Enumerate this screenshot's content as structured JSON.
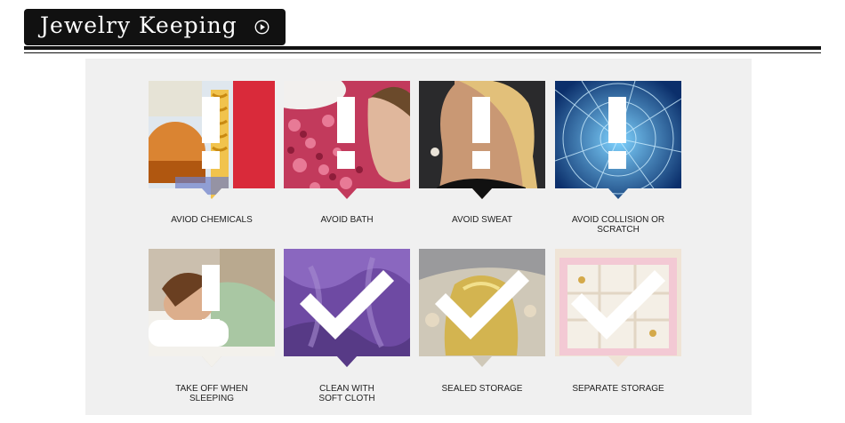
{
  "header": {
    "title": "Jewelry Keeping",
    "arrow_icon": "play-circle-icon"
  },
  "colors": {
    "header_bg": "#111111",
    "panel_bg": "#f0f0f0",
    "caption": "#222222"
  },
  "tips": [
    {
      "line1": "AVIOD CHEMICALS",
      "line2": "",
      "kind": "warning",
      "scene": "chemicals"
    },
    {
      "line1": "AVOID BATH",
      "line2": "",
      "kind": "warning",
      "scene": "bath"
    },
    {
      "line1": "AVOID SWEAT",
      "line2": "",
      "kind": "warning",
      "scene": "sweat"
    },
    {
      "line1": "AVOID COLLISION OR",
      "line2": "SCRATCH",
      "kind": "warning",
      "scene": "collision"
    },
    {
      "line1": "TAKE OFF WHEN",
      "line2": "SLEEPING",
      "kind": "warning",
      "scene": "sleeping"
    },
    {
      "line1": "CLEAN WITH",
      "line2": "SOFT CLOTH",
      "kind": "check",
      "scene": "cloth"
    },
    {
      "line1": "SEALED STORAGE",
      "line2": "",
      "kind": "check",
      "scene": "storage"
    },
    {
      "line1": "SEPARATE STORAGE",
      "line2": "",
      "kind": "check",
      "scene": "box"
    }
  ]
}
